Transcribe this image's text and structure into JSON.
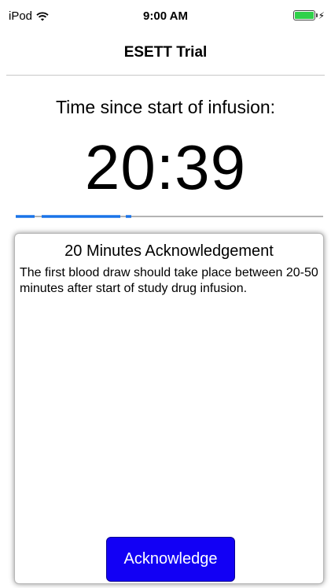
{
  "status_bar": {
    "carrier": "iPod",
    "time": "9:00 AM",
    "battery_level": 1.0,
    "battery_color": "#2fd14a",
    "icons": [
      "wifi-icon",
      "battery-icon",
      "charging-bolt-icon"
    ]
  },
  "nav": {
    "title": "ESETT Trial"
  },
  "timer": {
    "label": "Time since start of infusion:",
    "value": "20:39"
  },
  "progress": {
    "filled_color": "#1a73e8",
    "track_color": "#b3b3b3"
  },
  "acknowledgement": {
    "title": "20 Minutes Acknowledgement",
    "message": "The first blood draw should take place between 20-50 minutes after start of study drug infusion.",
    "button_label": "Acknowledge",
    "button_color": "#1200f5"
  }
}
